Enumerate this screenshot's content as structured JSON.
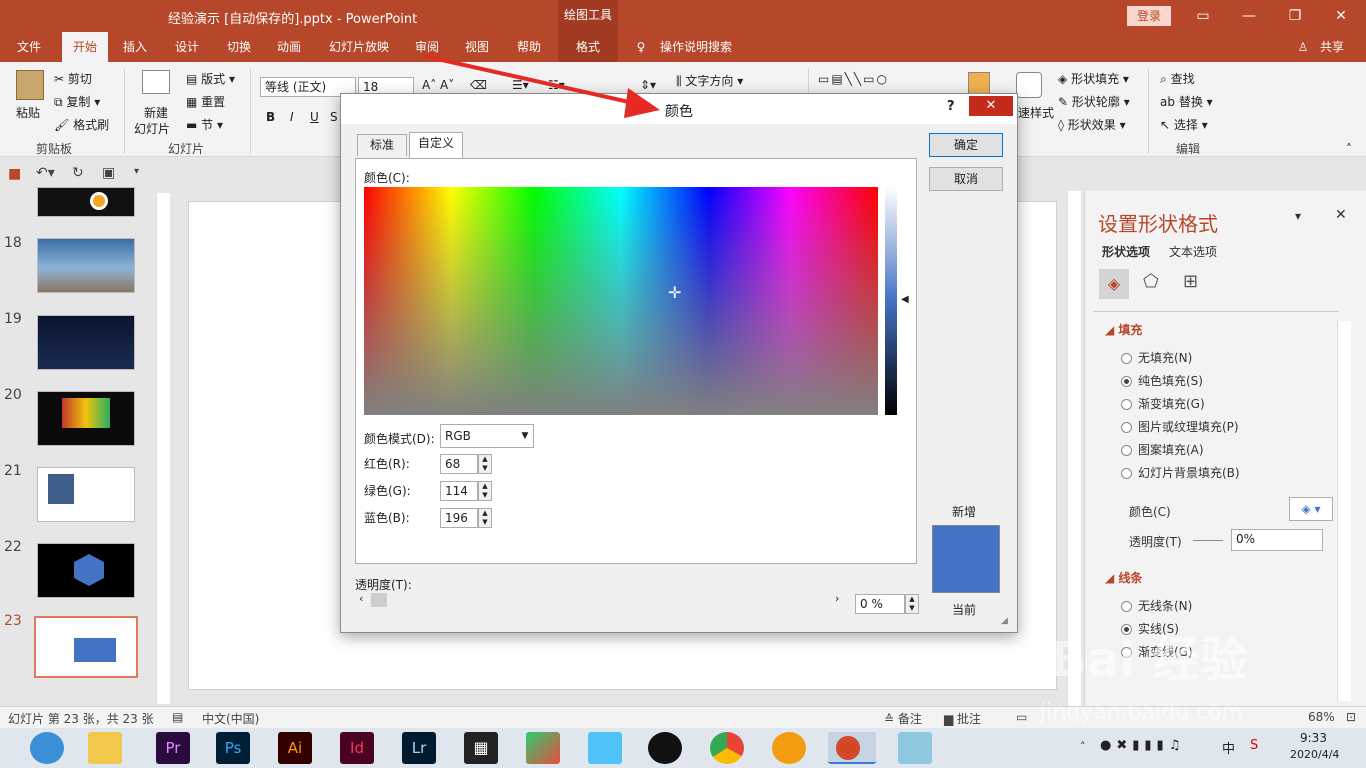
{
  "titlebar": {
    "title": "经验演示 [自动保存的].pptx  -  PowerPoint",
    "context_tool": "绘图工具",
    "login": "登录"
  },
  "tabs": [
    "文件",
    "开始",
    "插入",
    "设计",
    "切换",
    "动画",
    "幻灯片放映",
    "审阅",
    "视图",
    "帮助",
    "格式"
  ],
  "tell_me": "操作说明搜索",
  "share": "共享",
  "ribbon": {
    "paste": "粘贴",
    "cut": "剪切",
    "copy": "复制",
    "format_painter": "格式刷",
    "clipboard_group": "剪贴板",
    "new_slide": "新建",
    "new_slide2": "幻灯片",
    "layout": "版式",
    "reset": "重置",
    "section": "节",
    "slides_group": "幻灯片",
    "font_name": "等线 (正文)",
    "font_size": "18",
    "bold": "B",
    "italic": "I",
    "underline": "U",
    "strike": "S",
    "text_direction": "文字方向",
    "quick_styles": "速样式",
    "shape_fill": "形状填充",
    "shape_outline": "形状轮廓",
    "shape_effects": "形状效果",
    "find": "查找",
    "replace": "替换",
    "select": "选择",
    "edit_group": "编辑"
  },
  "slides": [
    {
      "num": "18"
    },
    {
      "num": "19"
    },
    {
      "num": "20"
    },
    {
      "num": "21"
    },
    {
      "num": "22"
    },
    {
      "num": "23"
    }
  ],
  "format_pane": {
    "title": "设置形状格式",
    "tab_shape": "形状选项",
    "tab_text": "文本选项",
    "fill_section": "填充",
    "fill_options": [
      "无填充(N)",
      "纯色填充(S)",
      "渐变填充(G)",
      "图片或纹理填充(P)",
      "图案填充(A)",
      "幻灯片背景填充(B)"
    ],
    "fill_selected": 1,
    "color_label": "颜色(C)",
    "transparency_label": "透明度(T)",
    "transparency_value": "0%",
    "line_section": "线条",
    "line_options": [
      "无线条(N)",
      "实线(S)",
      "渐变线(G)"
    ],
    "line_selected": 1
  },
  "dialog": {
    "title": "颜色",
    "help": "?",
    "close": "✕",
    "tab_standard": "标准",
    "tab_custom": "自定义",
    "colors_label": "颜色(C):",
    "mode_label": "颜色模式(D):",
    "mode_value": "RGB",
    "red_label": "红色(R):",
    "red_value": "68",
    "green_label": "绿色(G):",
    "green_value": "114",
    "blue_label": "蓝色(B):",
    "blue_value": "196",
    "transparency_label": "透明度(T):",
    "transparency_value": "0 %",
    "ok": "确定",
    "cancel": "取消",
    "new_label": "新增",
    "current_label": "当前",
    "preview_color": "#4472c4"
  },
  "status": {
    "slide_info": "幻灯片 第 23 张，共 23 张",
    "language": "中文(中国)",
    "notes": "备注",
    "comments": "批注",
    "zoom": "68%"
  },
  "taskbar": {
    "time": "9:33",
    "date": "2020/4/4",
    "ime": "中"
  },
  "watermark": {
    "text": "Bai 经验",
    "url": "jingyan.baidu.com"
  }
}
